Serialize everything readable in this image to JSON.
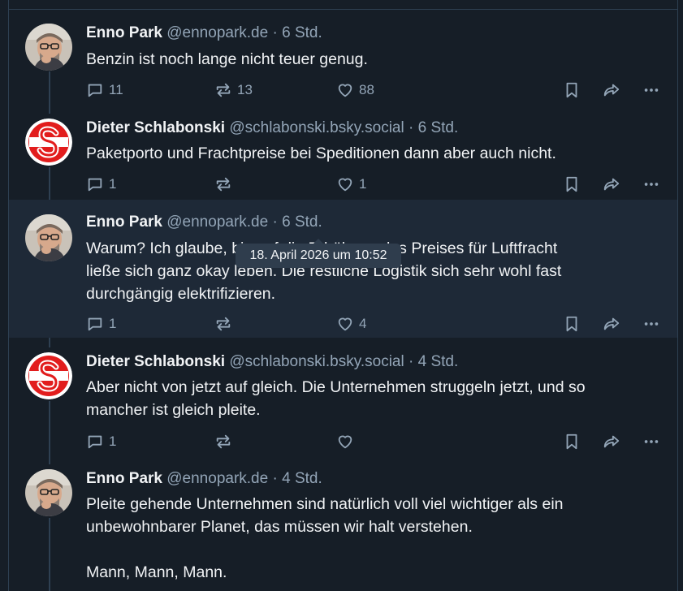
{
  "tooltip": "18. April 2026 um 10:52",
  "colors": {
    "background": "#161e27",
    "hover_row": "#1e2937",
    "muted": "#93a5b7",
    "logo_red": "#e21d1d"
  },
  "posts": [
    {
      "name": "Enno Park",
      "handle": "@ennopark.de",
      "sep": "·",
      "time": "6 Std.",
      "text": "Benzin ist noch lange nicht teuer genug.",
      "replies": "11",
      "reposts": "13",
      "likes": "88",
      "avatar": "person-photo"
    },
    {
      "name": "Dieter Schlabonski",
      "handle": "@schlabonski.bsky.social",
      "sep": "·",
      "time": "6 Std.",
      "text": "Paketporto und Frachtpreise bei Speditionen dann aber auch nicht.",
      "replies": "1",
      "reposts": "",
      "likes": "1",
      "avatar": "s-logo"
    },
    {
      "name": "Enno Park",
      "handle": "@ennopark.de",
      "sep": "·",
      "time": "6 Std.",
      "text": "Warum? Ich glaube, bis auf die Erhöhung des Preises für Luftfracht\nließe sich ganz okay leben. Die restliche Logistik sich sehr wohl fast\ndurchgängig elektrifizieren.",
      "replies": "1",
      "reposts": "",
      "likes": "4",
      "avatar": "person-photo"
    },
    {
      "name": "Dieter Schlabonski",
      "handle": "@schlabonski.bsky.social",
      "sep": "·",
      "time": "4 Std.",
      "text": "Aber nicht von jetzt auf gleich.  Die Unternehmen struggeln jetzt, und so\nmancher ist gleich pleite.",
      "replies": "1",
      "reposts": "",
      "likes": "",
      "avatar": "s-logo"
    },
    {
      "name": "Enno Park",
      "handle": "@ennopark.de",
      "sep": "·",
      "time": "4 Std.",
      "text": "Pleite gehende Unternehmen sind natürlich voll viel wichtiger als ein\nunbewohnbarer Planet, das müssen wir halt verstehen.\n\nMann, Mann, Mann.",
      "avatar": "person-photo"
    }
  ]
}
